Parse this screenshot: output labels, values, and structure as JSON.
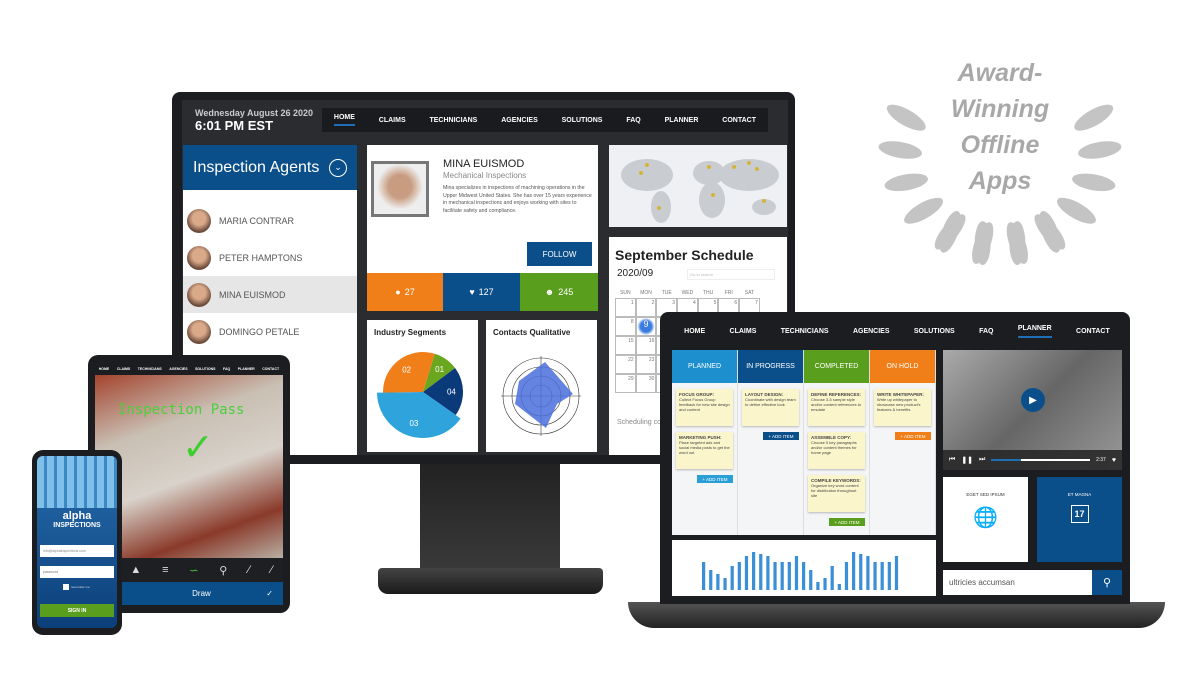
{
  "monitor": {
    "date": "Wednesday August 26 2020",
    "time": "6:01 PM EST",
    "nav": [
      "HOME",
      "CLAIMS",
      "TECHNICIANS",
      "AGENCIES",
      "SOLUTIONS",
      "FAQ",
      "PLANNER",
      "CONTACT"
    ],
    "active_nav": "HOME",
    "agents_title": "Inspection Agents",
    "agents": [
      "MARIA CONTRAR",
      "PETER HAMPTONS",
      "MINA EUISMOD",
      "DOMINGO PETALE"
    ],
    "selected_agent": "MINA EUISMOD",
    "profile": {
      "name": "MINA EUISMOD",
      "role": "Mechanical Inspections",
      "bio": "Mina specializes in inspections of machining operations in the Upper Midwest United States. She has over 15 years experience in mechanical inspections and enjoys working with sites to facilitate safety and compliance.",
      "follow": "FOLLOW",
      "comments": "27",
      "likes": "127",
      "followers": "245"
    },
    "schedule": {
      "title": "September Schedule",
      "month": "2020/09",
      "search_placeholder": "Go to search",
      "weekdays": [
        "SUN",
        "MON",
        "TUE",
        "WED",
        "THU",
        "FRI",
        "SAT"
      ],
      "days": [
        "1",
        "2",
        "3",
        "4",
        "5",
        "6",
        "7",
        "8",
        "9",
        "",
        "",
        "",
        "",
        "",
        "15",
        "16",
        "",
        "",
        "",
        "",
        "",
        "22",
        "23",
        "",
        "",
        "",
        "",
        "",
        "29",
        "30",
        "",
        "",
        "",
        "",
        ""
      ],
      "highlighted_day": "9",
      "footer": "Scheduling co... for the remain..."
    },
    "industry_title": "Industry Segments",
    "industry_slices": [
      {
        "label": "01",
        "value": 10,
        "color": "#6aa61e"
      },
      {
        "label": "04",
        "value": 20,
        "color": "#0b3a7a"
      },
      {
        "label": "03",
        "value": 40,
        "color": "#2ea3dc"
      },
      {
        "label": "02",
        "value": 30,
        "color": "#f07f1a"
      }
    ],
    "contacts_title": "Contacts Qualitative"
  },
  "laptop": {
    "nav": [
      "HOME",
      "CLAIMS",
      "TECHNICIANS",
      "AGENCIES",
      "SOLUTIONS",
      "FAQ",
      "PLANNER",
      "CONTACT"
    ],
    "active_nav": "PLANNER",
    "columns": [
      {
        "title": "PLANNED",
        "color": "#1d8fcf",
        "add_color": "#2a9fd6",
        "add": "+ ADD ITEM",
        "notes": [
          {
            "title": "FOCUS GROUP:",
            "text": "Collect Focus Group feedback for new site design and content"
          },
          {
            "title": "MARKETING PUSH:",
            "text": "Place targeted ads and social media posts to get the word out"
          }
        ]
      },
      {
        "title": "IN PROGRESS",
        "color": "#0b4f8a",
        "add_color": "#0b4f8a",
        "add": "+ ADD ITEM",
        "notes": [
          {
            "title": "LAYOUT DESIGN:",
            "text": "Coordinate with design team to define effective look"
          }
        ]
      },
      {
        "title": "COMPLETED",
        "color": "#5a9e1e",
        "add_color": "#5a9e1e",
        "add": "+ ADD ITEM",
        "notes": [
          {
            "title": "DEFINE REFERENCES:",
            "text": "Choose 3-5 sample style and/or content references to emulate"
          },
          {
            "title": "ASSEMBLE COPY:",
            "text": "Choose 5 key paragraphs and/or content themes for home page"
          },
          {
            "title": "COMPILE KEYWORDS:",
            "text": "Organize key word content for distribution throughout site"
          }
        ]
      },
      {
        "title": "ON HOLD",
        "color": "#f07f1a",
        "add_color": "#f07f1a",
        "add": "+ ADD ITEM",
        "notes": [
          {
            "title": "WRITE WHITEPAPER:",
            "text": "Write up whitepaper to showcase new product's features & benefits"
          }
        ]
      }
    ],
    "bar_values": [
      0.7,
      0.5,
      0.4,
      0.3,
      0.6,
      0.7,
      0.85,
      0.95,
      0.9,
      0.85,
      0.7,
      0.7,
      0.7,
      0.85,
      0.7,
      0.5,
      0.2,
      0.3,
      0.6,
      0.15,
      0.7,
      0.95,
      0.9,
      0.85,
      0.7,
      0.7,
      0.7,
      0.85
    ],
    "video_time": "2:37",
    "video_progress": 0.3,
    "card1_title": "EGET SED IPSUM",
    "card2_title": "ET MAGNA",
    "calendar_day": "17",
    "search_value": "ultricies accumsan"
  },
  "tablet": {
    "nav": [
      "HOME",
      "CLAIMS",
      "TECHNICIANS",
      "AGENCIES",
      "SOLUTIONS",
      "FAQ",
      "PLANNER",
      "CONTACT"
    ],
    "annotation": "Inspection Pass",
    "draw_label": "Draw"
  },
  "phone": {
    "brand_line1": "alpha",
    "brand_line2": "INSPECTIONS",
    "email_value": "info@alphainspections.com",
    "password_placeholder": "password",
    "remember": "remember me",
    "sign_in": "SIGN IN"
  },
  "award": {
    "lines": [
      "Award-",
      "Winning",
      "Offline",
      "Apps"
    ]
  },
  "colors": {
    "brand_blue": "#0b4f8a",
    "orange": "#f07f1a",
    "green": "#5a9e1e",
    "light_blue": "#1d8fcf"
  }
}
